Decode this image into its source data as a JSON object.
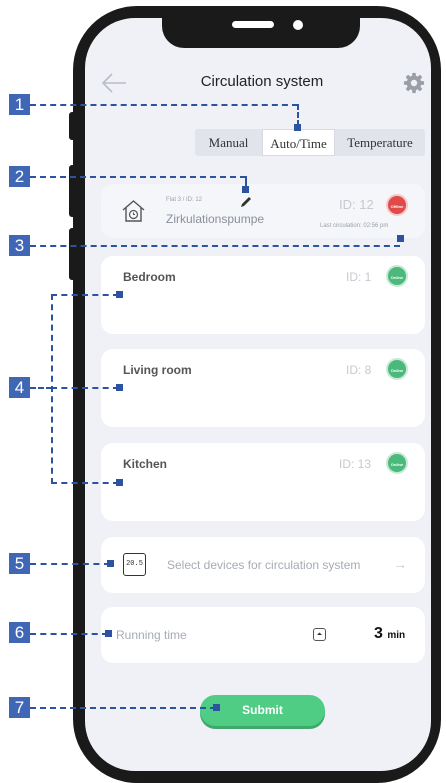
{
  "header": {
    "title": "Circulation system",
    "back_icon": "arrow-left-icon",
    "settings_icon": "gear-icon"
  },
  "tabs": [
    {
      "label": "Manual",
      "active": false
    },
    {
      "label": "Auto/Time",
      "active": true
    },
    {
      "label": "Temperature",
      "active": false
    }
  ],
  "pump": {
    "icon": "house-clock-icon",
    "meta": "Flat 3 / ID: 12",
    "name": "Zirkulationspumpe",
    "id_label": "ID: 12",
    "status": "Offline",
    "last_circulation": "Last circulation: 02:56 pm",
    "edit_icon": "pencil-icon"
  },
  "rooms": [
    {
      "name": "Bedroom",
      "id_label": "ID: 1",
      "status": "Online"
    },
    {
      "name": "Living room",
      "id_label": "ID: 8",
      "status": "Online"
    },
    {
      "name": "Kitchen",
      "id_label": "ID: 13",
      "status": "Online"
    }
  ],
  "select_devices": {
    "icon": "thermostat-icon",
    "icon_text": "20.5",
    "label": "Select devices for circulation system",
    "arrow_icon": "arrow-right-icon"
  },
  "running_time": {
    "label": "Running time",
    "value": "3",
    "unit": "min",
    "stepper_icon": "stepper-icon"
  },
  "submit": {
    "label": "Submit"
  },
  "callouts": [
    "1",
    "2",
    "3",
    "4",
    "5",
    "6",
    "7"
  ],
  "colors": {
    "accent_green": "#4fcd84",
    "online": "#4cb97c",
    "offline": "#e04a4a",
    "callout_blue": "#3f67b5",
    "background": "#eff1f7"
  }
}
